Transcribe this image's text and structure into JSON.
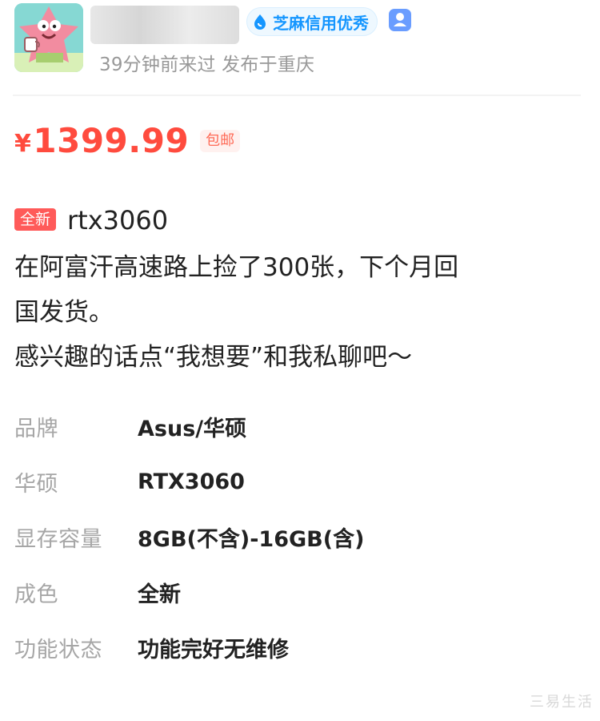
{
  "seller": {
    "avatar_icon": "patrick-star-avatar",
    "credit_badge": "芝麻信用优秀",
    "meta": "39分钟前来过 发布于重庆",
    "verified_icon": "verified-user-icon"
  },
  "price": {
    "symbol": "¥",
    "amount": "1399.99",
    "shipping": "包邮"
  },
  "item": {
    "condition_tag": "全新",
    "title": "rtx3060",
    "description_lines": [
      "在阿富汗高速路上捡了300张，下个月回",
      "国发货。",
      "感兴趣的话点“我想要”和我私聊吧～"
    ]
  },
  "specs": [
    {
      "label": "品牌",
      "value": "Asus/华硕"
    },
    {
      "label": "华硕",
      "value": "RTX3060"
    },
    {
      "label": "显存容量",
      "value": "8GB(不含)-16GB(含)"
    },
    {
      "label": "成色",
      "value": "全新"
    },
    {
      "label": "功能状态",
      "value": "功能完好无维修"
    }
  ],
  "watermark": "三易生活",
  "colors": {
    "price": "#ff4b3e",
    "credit": "#1596ff",
    "new_tag": "#ff5a59"
  }
}
